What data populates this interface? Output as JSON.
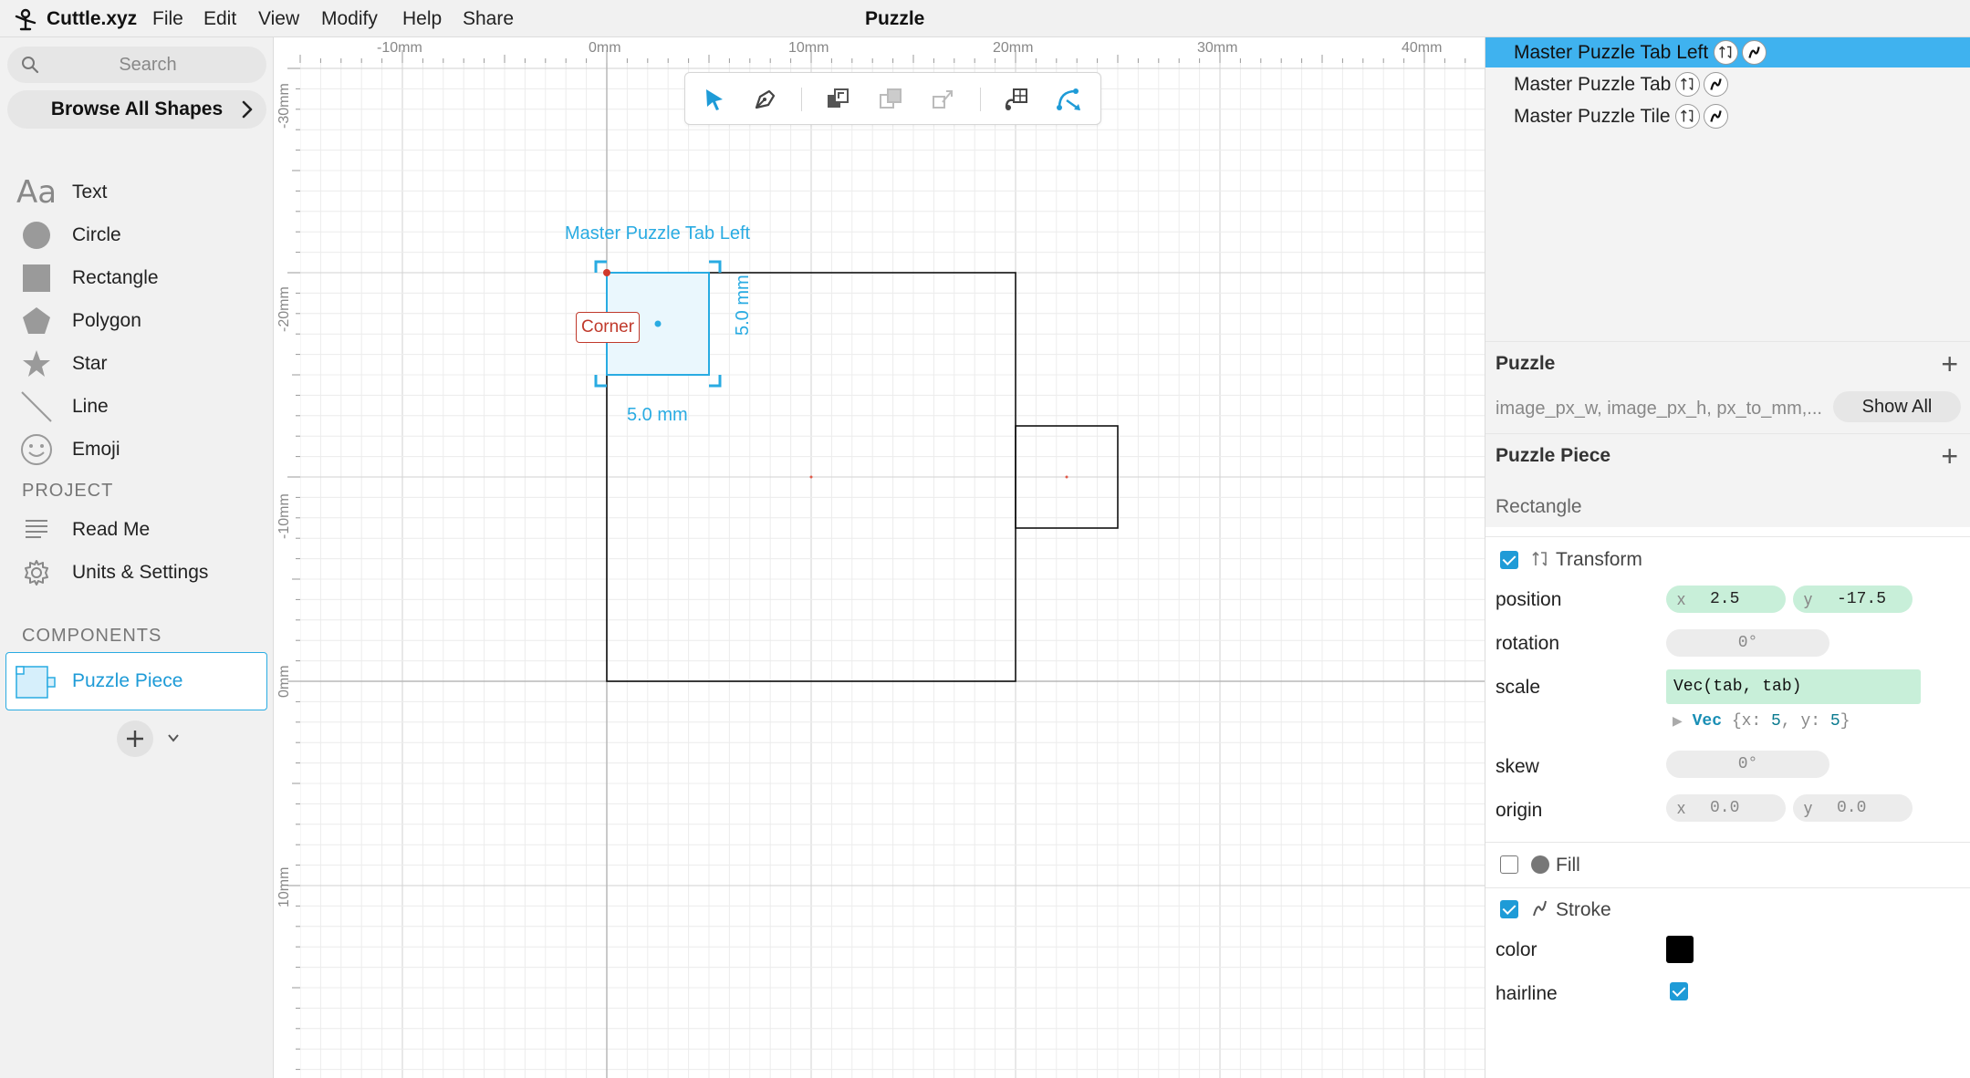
{
  "app": {
    "name": "Cuttle.xyz",
    "menus": [
      "File",
      "Edit",
      "View",
      "Modify",
      "Help",
      "Share"
    ],
    "document_title": "Puzzle"
  },
  "sidebar": {
    "search_placeholder": "Search",
    "browse_label": "Browse All Shapes",
    "shapes": [
      {
        "label": "Text",
        "icon": "text-icon"
      },
      {
        "label": "Circle",
        "icon": "circle-icon"
      },
      {
        "label": "Rectangle",
        "icon": "rectangle-icon"
      },
      {
        "label": "Polygon",
        "icon": "polygon-icon"
      },
      {
        "label": "Star",
        "icon": "star-icon"
      },
      {
        "label": "Line",
        "icon": "line-icon"
      },
      {
        "label": "Emoji",
        "icon": "emoji-icon"
      }
    ],
    "project_heading": "PROJECT",
    "project_items": [
      {
        "label": "Read Me",
        "icon": "readme-icon"
      },
      {
        "label": "Units & Settings",
        "icon": "gear-icon"
      }
    ],
    "components_heading": "COMPONENTS",
    "components": [
      {
        "label": "Puzzle Piece"
      }
    ],
    "text_icon_glyph": "Aa"
  },
  "canvas": {
    "ruler_x_labels": [
      "-10mm",
      "0mm",
      "10mm",
      "20mm",
      "30mm",
      "40mm"
    ],
    "ruler_y_labels": [
      "-30mm",
      "-20mm",
      "-10mm",
      "0mm",
      "10mm"
    ],
    "selection_label": "Master Puzzle Tab Left",
    "corner_tag": "Corner",
    "dim_width": "5.0 mm",
    "dim_height": "5.0 mm",
    "accent_color": "#29abe2"
  },
  "panel": {
    "layers": [
      {
        "name": "Master Puzzle Tab Left",
        "active": true
      },
      {
        "name": "Master Puzzle Tab",
        "active": false
      },
      {
        "name": "Master Puzzle Tile",
        "active": false
      }
    ],
    "puzzle_section": {
      "title": "Puzzle",
      "vars": "image_px_w, image_px_h, px_to_mm,...",
      "show_all_label": "Show All"
    },
    "piece_section": {
      "title": "Puzzle Piece"
    },
    "shape_type": "Rectangle",
    "transform_label": "Transform",
    "position": {
      "label": "position",
      "x_axis": "x",
      "x": "2.5",
      "y_axis": "y",
      "y": "-17.5"
    },
    "rotation": {
      "label": "rotation",
      "value": "0°"
    },
    "scale": {
      "label": "scale",
      "value": "Vec(tab, tab)",
      "hint_type": "Vec",
      "hint_open": "{x:",
      "hint_x": "5",
      "hint_mid": ", y:",
      "hint_y": "5",
      "hint_close": "}"
    },
    "skew": {
      "label": "skew",
      "value": "0°"
    },
    "origin": {
      "label": "origin",
      "x_axis": "x",
      "x": "0.0",
      "y_axis": "y",
      "y": "0.0"
    },
    "fill_label": "Fill",
    "stroke_label": "Stroke",
    "color_label": "color",
    "stroke_color": "#000000",
    "hairline_label": "hairline"
  }
}
